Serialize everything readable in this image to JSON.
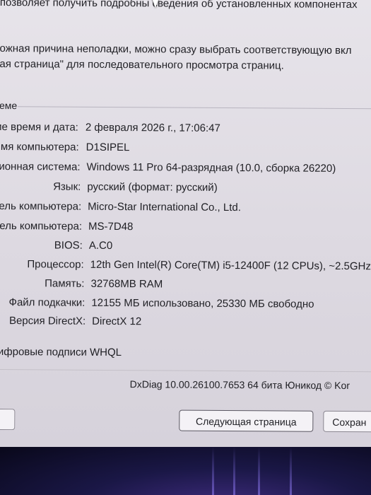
{
  "intro": {
    "line1": "позволяет получить подробны сведения об установленных компонентах",
    "line2": "ожная причина неполадки, можно сразу выбрать соответствующую вкл",
    "line3": "ая страница\" для последовательного просмотра страниц."
  },
  "group_title": "еме",
  "system_info": [
    {
      "label": "ие время и дата:",
      "value": "2 февраля 2026 г., 17:06:47"
    },
    {
      "label": "мя компьютера:",
      "value": "D1SIPEL"
    },
    {
      "label": "ионная система:",
      "value": "Windows 11 Pro 64-разрядная (10.0, сборка 26220)"
    },
    {
      "label": "Язык:",
      "value": "русский (формат: русский)"
    },
    {
      "label": "ель компьютера:",
      "value": "Micro-Star International Co., Ltd."
    },
    {
      "label": "ель компьютера:",
      "value": "MS-7D48"
    },
    {
      "label": "BIOS:",
      "value": "A.C0"
    },
    {
      "label": "Процессор:",
      "value": "12th Gen Intel(R) Core(TM) i5-12400F (12 CPUs), ~2.5GHz"
    },
    {
      "label": "Память:",
      "value": "32768MB RAM"
    },
    {
      "label": "Файл подкачки:",
      "value": "12155 МБ использовано, 25330 МБ свободно"
    },
    {
      "label": "Версия DirectX:",
      "value": "DirectX 12"
    }
  ],
  "whql": "ифровые подписи WHQL",
  "version_line": "DxDiag 10.00.26100.7653 64 бита Юникод © Kor",
  "buttons": {
    "next_page": "Следующая страница",
    "save": "Сохран"
  }
}
